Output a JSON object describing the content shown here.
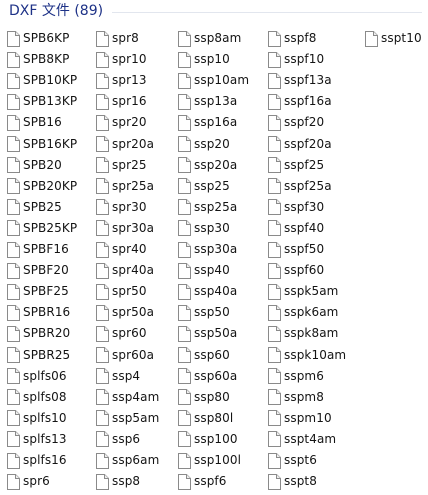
{
  "group": {
    "title": "DXF 文件 (89)"
  },
  "icon_name": "document-icon",
  "columns": [
    {
      "name": "column-1",
      "files": [
        "SPB6KP",
        "SPB8KP",
        "SPB10KP",
        "SPB13KP",
        "SPB16",
        "SPB16KP",
        "SPB20",
        "SPB20KP",
        "SPB25",
        "SPB25KP",
        "SPBF16",
        "SPBF20",
        "SPBF25",
        "SPBR16",
        "SPBR20",
        "SPBR25",
        "splfs06",
        "splfs08",
        "splfs10",
        "splfs13",
        "splfs16",
        "spr6"
      ]
    },
    {
      "name": "column-2",
      "files": [
        "spr8",
        "spr10",
        "spr13",
        "spr16",
        "spr20",
        "spr20a",
        "spr25",
        "spr25a",
        "spr30",
        "spr30a",
        "spr40",
        "spr40a",
        "spr50",
        "spr50a",
        "spr60",
        "spr60a",
        "ssp4",
        "ssp4am",
        "ssp5am",
        "ssp6",
        "ssp6am",
        "ssp8"
      ]
    },
    {
      "name": "column-3",
      "files": [
        "ssp8am",
        "ssp10",
        "ssp10am",
        "ssp13a",
        "ssp16a",
        "ssp20",
        "ssp20a",
        "ssp25",
        "ssp25a",
        "ssp30",
        "ssp30a",
        "ssp40",
        "ssp40a",
        "ssp50",
        "ssp50a",
        "ssp60",
        "ssp60a",
        "ssp80",
        "ssp80l",
        "ssp100",
        "ssp100l",
        "sspf6"
      ]
    },
    {
      "name": "column-4",
      "files": [
        "sspf8",
        "sspf10",
        "sspf13a",
        "sspf16a",
        "sspf20",
        "sspf20a",
        "sspf25",
        "sspf25a",
        "sspf30",
        "sspf40",
        "sspf50",
        "sspf60",
        "sspk5am",
        "sspk6am",
        "sspk8am",
        "sspk10am",
        "sspm6",
        "sspm8",
        "sspm10",
        "sspt4am",
        "sspt6",
        "sspt8"
      ]
    },
    {
      "name": "column-5",
      "files": [
        "sspt10"
      ]
    }
  ]
}
